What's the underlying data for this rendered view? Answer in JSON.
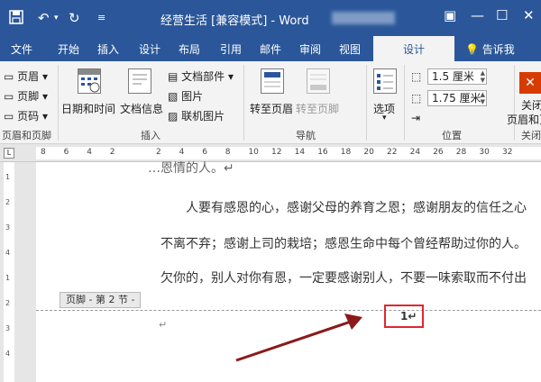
{
  "window": {
    "title": "经营生活 [兼容模式] - Word",
    "quick_access": {
      "save_icon": "save-icon",
      "undo_icon": "undo-icon",
      "redo_icon": "redo-icon",
      "customize_icon": "customize-icon"
    },
    "controls": [
      "restore-icon",
      "minimize-icon",
      "maximize-icon",
      "close-icon"
    ]
  },
  "tabs": [
    "文件",
    "开始",
    "插入",
    "设计",
    "布局",
    "引用",
    "邮件",
    "审阅",
    "视图"
  ],
  "active_tab": "设计",
  "tell_me": "告诉我",
  "ribbon": {
    "header_footer": {
      "header": "页眉",
      "footer": "页脚",
      "page_number": "页码",
      "label": "页眉和页脚"
    },
    "insert": {
      "date_time": "日期和时间",
      "doc_info": "文档信息",
      "quick_parts": "文档部件",
      "picture": "图片",
      "online_picture": "联机图片",
      "label": "插入"
    },
    "navigation": {
      "goto_header": "转至页眉",
      "goto_footer": "转至页脚",
      "label": "导航"
    },
    "options": {
      "label_btn": "选项"
    },
    "position": {
      "header_top": "1.5 厘米",
      "footer_bottom": "1.75 厘米",
      "label": "位置"
    },
    "close": {
      "btn_line1": "关闭",
      "btn_line2": "页眉和页",
      "label": "关闭"
    }
  },
  "ruler": {
    "ticks": [
      "8",
      "6",
      "4",
      "2",
      "",
      "2",
      "4",
      "6",
      "8",
      "10",
      "12",
      "14",
      "16",
      "18",
      "20",
      "22",
      "24",
      "26",
      "28",
      "30",
      "32"
    ]
  },
  "document": {
    "top_fragment": "…恩情的人。↵",
    "para1": "人要有感恩的心，感谢父母的养育之恩；感谢朋友的信任之心",
    "para2": "不离不弃；感谢上司的栽培；感恩生命中每个曾经帮助过你的人。",
    "para3": "欠你的，别人对你有恩，一定要感谢别人，不要一味索取而不付出",
    "footer_tag": "页脚 - 第 2 节 -",
    "page_number": "1↵",
    "empty_mark": "↵"
  },
  "colors": {
    "accent": "#2b579a",
    "highlight_box": "#e0262f",
    "arrow": "#8b1a1a"
  }
}
